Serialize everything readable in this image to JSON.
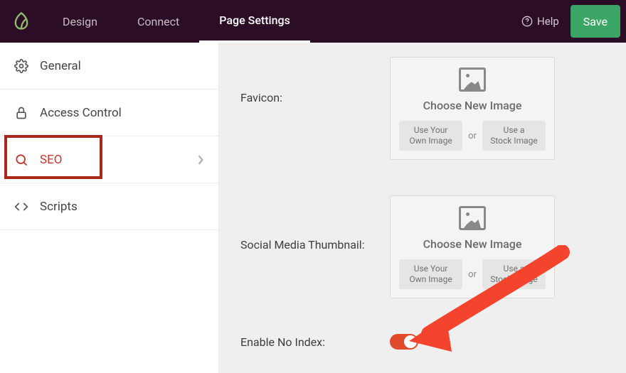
{
  "header": {
    "tabs": [
      "Design",
      "Connect",
      "Page Settings"
    ],
    "active_tab": "Page Settings",
    "help_label": "Help",
    "save_label": "Save"
  },
  "sidebar": {
    "items": [
      {
        "key": "general",
        "label": "General",
        "icon": "gear-icon"
      },
      {
        "key": "access",
        "label": "Access Control",
        "icon": "lock-icon"
      },
      {
        "key": "seo",
        "label": "SEO",
        "icon": "search-icon",
        "active": true
      },
      {
        "key": "scripts",
        "label": "Scripts",
        "icon": "code-icon"
      }
    ]
  },
  "content": {
    "favicon_label": "Favicon:",
    "social_label": "Social Media Thumbnail:",
    "noindex_label": "Enable No Index:",
    "image_card": {
      "choose": "Choose New Image",
      "own_line1": "Use Your",
      "own_line2": "Own Image",
      "or": "or",
      "stock_line1": "Use a",
      "stock_line2": "Stock Image"
    },
    "noindex_enabled": true
  }
}
